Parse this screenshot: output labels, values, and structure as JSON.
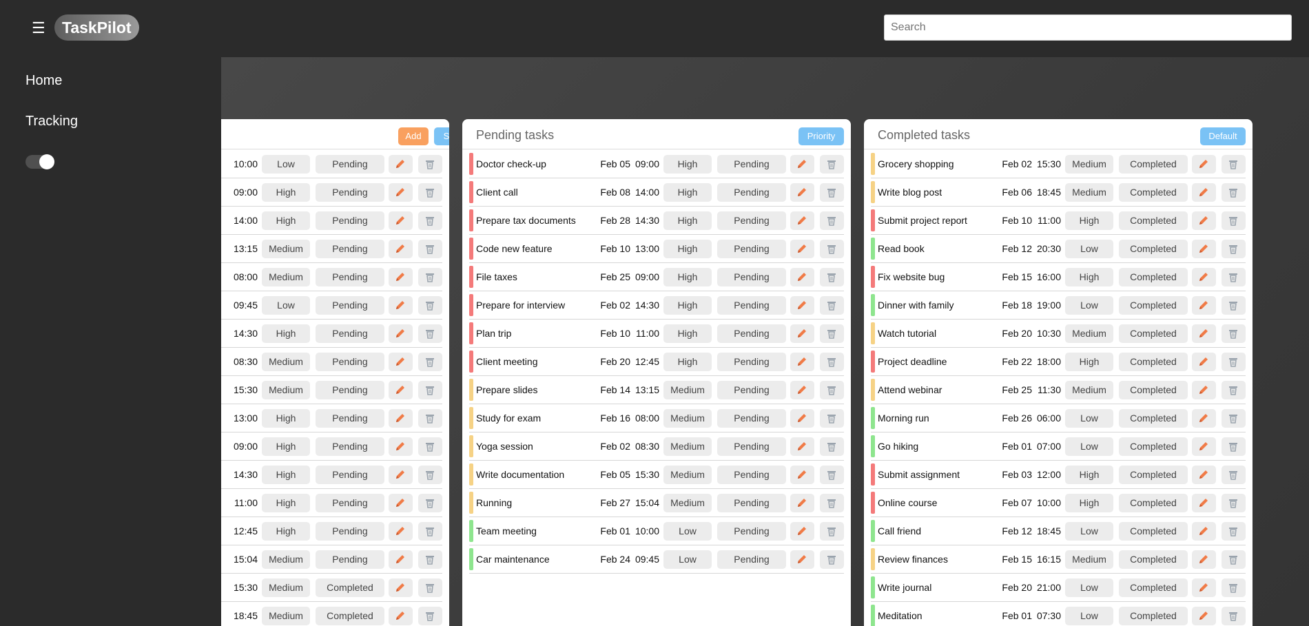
{
  "app": {
    "logo": "TaskPilot",
    "menu_icon": "☰"
  },
  "search": {
    "placeholder": "Search"
  },
  "sidebar": {
    "items": [
      {
        "label": "Home"
      },
      {
        "label": "Tracking"
      }
    ],
    "theme_toggle_on": true
  },
  "colors": {
    "high": "#f47a7a",
    "medium": "#f6d285",
    "low": "#8ee58e",
    "edit_icon": "#f07b47",
    "delete_icon": "#9aa3ad"
  },
  "columns": [
    {
      "title": "",
      "buttons": [
        {
          "label": "Add",
          "color": "orange"
        },
        {
          "label": "Status",
          "color": "blue"
        }
      ],
      "tasks": [
        {
          "name": "",
          "date": "",
          "time": "10:00",
          "priority": "Low",
          "status": "Pending"
        },
        {
          "name": "",
          "date": "",
          "time": "09:00",
          "priority": "High",
          "status": "Pending"
        },
        {
          "name": "",
          "date": "",
          "time": "14:00",
          "priority": "High",
          "status": "Pending"
        },
        {
          "name": "",
          "date": "",
          "time": "13:15",
          "priority": "Medium",
          "status": "Pending"
        },
        {
          "name": "",
          "date": "",
          "time": "08:00",
          "priority": "Medium",
          "status": "Pending"
        },
        {
          "name": "",
          "date": "",
          "time": "09:45",
          "priority": "Low",
          "status": "Pending"
        },
        {
          "name": "",
          "date": "",
          "time": "14:30",
          "priority": "High",
          "status": "Pending"
        },
        {
          "name": "",
          "date": "",
          "time": "08:30",
          "priority": "Medium",
          "status": "Pending"
        },
        {
          "name": "",
          "date": "",
          "time": "15:30",
          "priority": "Medium",
          "status": "Pending"
        },
        {
          "name": "",
          "date": "",
          "time": "13:00",
          "priority": "High",
          "status": "Pending"
        },
        {
          "name": "",
          "date": "",
          "time": "09:00",
          "priority": "High",
          "status": "Pending"
        },
        {
          "name": "",
          "date": "",
          "time": "14:30",
          "priority": "High",
          "status": "Pending"
        },
        {
          "name": "",
          "date": "",
          "time": "11:00",
          "priority": "High",
          "status": "Pending"
        },
        {
          "name": "",
          "date": "",
          "time": "12:45",
          "priority": "High",
          "status": "Pending"
        },
        {
          "name": "",
          "date": "",
          "time": "15:04",
          "priority": "Medium",
          "status": "Pending"
        },
        {
          "name": "",
          "date": "",
          "time": "15:30",
          "priority": "Medium",
          "status": "Completed"
        },
        {
          "name": "",
          "date": "",
          "time": "18:45",
          "priority": "Medium",
          "status": "Completed"
        }
      ]
    },
    {
      "title": "Pending tasks",
      "buttons": [
        {
          "label": "Priority",
          "color": "blue"
        }
      ],
      "tasks": [
        {
          "name": "Doctor check-up",
          "date": "Feb 05",
          "time": "09:00",
          "priority": "High",
          "status": "Pending"
        },
        {
          "name": "Client call",
          "date": "Feb 08",
          "time": "14:00",
          "priority": "High",
          "status": "Pending"
        },
        {
          "name": "Prepare tax documents",
          "date": "Feb 28",
          "time": "14:30",
          "priority": "High",
          "status": "Pending"
        },
        {
          "name": "Code new feature",
          "date": "Feb 10",
          "time": "13:00",
          "priority": "High",
          "status": "Pending"
        },
        {
          "name": "File taxes",
          "date": "Feb 25",
          "time": "09:00",
          "priority": "High",
          "status": "Pending"
        },
        {
          "name": "Prepare for interview",
          "date": "Feb 02",
          "time": "14:30",
          "priority": "High",
          "status": "Pending"
        },
        {
          "name": "Plan trip",
          "date": "Feb 10",
          "time": "11:00",
          "priority": "High",
          "status": "Pending"
        },
        {
          "name": "Client meeting",
          "date": "Feb 20",
          "time": "12:45",
          "priority": "High",
          "status": "Pending"
        },
        {
          "name": "Prepare slides",
          "date": "Feb 14",
          "time": "13:15",
          "priority": "Medium",
          "status": "Pending"
        },
        {
          "name": "Study for exam",
          "date": "Feb 16",
          "time": "08:00",
          "priority": "Medium",
          "status": "Pending"
        },
        {
          "name": "Yoga session",
          "date": "Feb 02",
          "time": "08:30",
          "priority": "Medium",
          "status": "Pending"
        },
        {
          "name": "Write documentation",
          "date": "Feb 05",
          "time": "15:30",
          "priority": "Medium",
          "status": "Pending"
        },
        {
          "name": "Running",
          "date": "Feb 27",
          "time": "15:04",
          "priority": "Medium",
          "status": "Pending"
        },
        {
          "name": "Team meeting",
          "date": "Feb 01",
          "time": "10:00",
          "priority": "Low",
          "status": "Pending"
        },
        {
          "name": "Car maintenance",
          "date": "Feb 24",
          "time": "09:45",
          "priority": "Low",
          "status": "Pending"
        }
      ]
    },
    {
      "title": "Completed tasks",
      "buttons": [
        {
          "label": "Default",
          "color": "blue"
        }
      ],
      "tasks": [
        {
          "name": "Grocery shopping",
          "date": "Feb 02",
          "time": "15:30",
          "priority": "Medium",
          "status": "Completed"
        },
        {
          "name": "Write blog post",
          "date": "Feb 06",
          "time": "18:45",
          "priority": "Medium",
          "status": "Completed"
        },
        {
          "name": "Submit project report",
          "date": "Feb 10",
          "time": "11:00",
          "priority": "High",
          "status": "Completed"
        },
        {
          "name": "Read book",
          "date": "Feb 12",
          "time": "20:30",
          "priority": "Low",
          "status": "Completed"
        },
        {
          "name": "Fix website bug",
          "date": "Feb 15",
          "time": "16:00",
          "priority": "High",
          "status": "Completed"
        },
        {
          "name": "Dinner with family",
          "date": "Feb 18",
          "time": "19:00",
          "priority": "Low",
          "status": "Completed"
        },
        {
          "name": "Watch tutorial",
          "date": "Feb 20",
          "time": "10:30",
          "priority": "Medium",
          "status": "Completed"
        },
        {
          "name": "Project deadline",
          "date": "Feb 22",
          "time": "18:00",
          "priority": "High",
          "status": "Completed"
        },
        {
          "name": "Attend webinar",
          "date": "Feb 25",
          "time": "11:30",
          "priority": "Medium",
          "status": "Completed"
        },
        {
          "name": "Morning run",
          "date": "Feb 26",
          "time": "06:00",
          "priority": "Low",
          "status": "Completed"
        },
        {
          "name": "Go hiking",
          "date": "Feb 01",
          "time": "07:00",
          "priority": "Low",
          "status": "Completed"
        },
        {
          "name": "Submit assignment",
          "date": "Feb 03",
          "time": "12:00",
          "priority": "High",
          "status": "Completed"
        },
        {
          "name": "Online course",
          "date": "Feb 07",
          "time": "10:00",
          "priority": "High",
          "status": "Completed"
        },
        {
          "name": "Call friend",
          "date": "Feb 12",
          "time": "18:45",
          "priority": "Low",
          "status": "Completed"
        },
        {
          "name": "Review finances",
          "date": "Feb 15",
          "time": "16:15",
          "priority": "Medium",
          "status": "Completed"
        },
        {
          "name": "Write journal",
          "date": "Feb 20",
          "time": "21:00",
          "priority": "Low",
          "status": "Completed"
        },
        {
          "name": "Meditation",
          "date": "Feb 01",
          "time": "07:30",
          "priority": "Low",
          "status": "Completed"
        }
      ]
    }
  ]
}
